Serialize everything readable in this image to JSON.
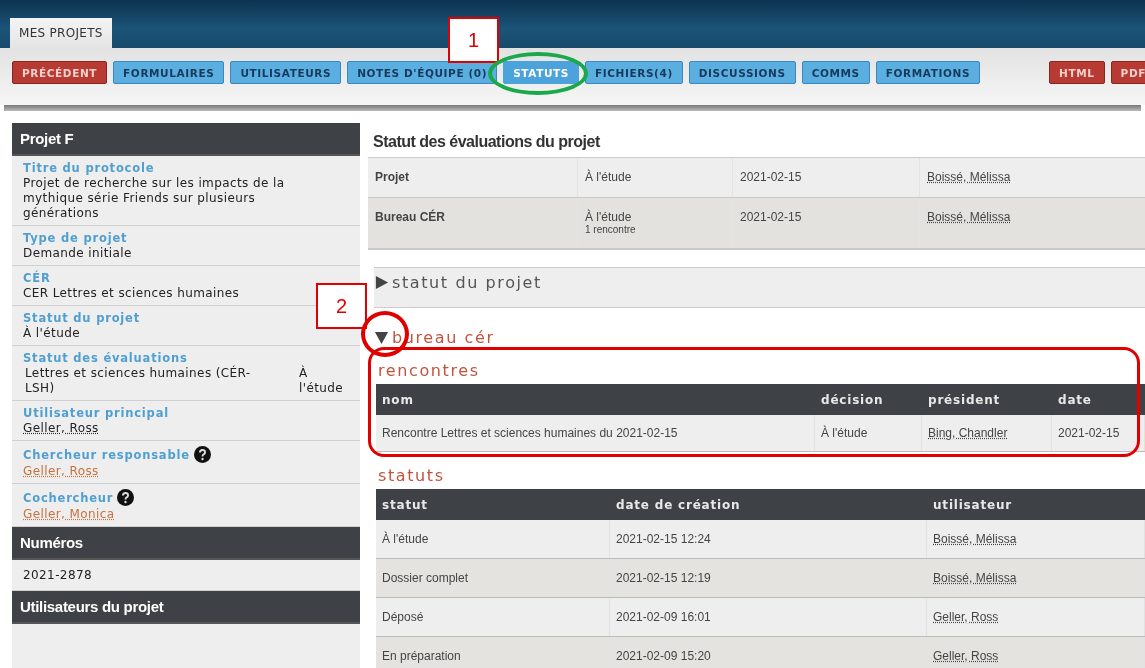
{
  "top_tabs": [
    {
      "label": "MES PROJETS",
      "selected": true
    }
  ],
  "toolbar": [
    {
      "label": "PRÉCÉDENT",
      "kind": "danger",
      "selected": false
    },
    {
      "label": "FORMULAIRES",
      "kind": "primary",
      "selected": false
    },
    {
      "label": "UTILISATEURS",
      "kind": "primary",
      "selected": false
    },
    {
      "label": "NOTES D'ÉQUIPE (0)",
      "kind": "primary",
      "selected": false
    },
    {
      "label": "STATUTS",
      "kind": "primary",
      "selected": true
    },
    {
      "label": "FICHIERS(4)",
      "kind": "primary",
      "selected": false
    },
    {
      "label": "DISCUSSIONS",
      "kind": "primary",
      "selected": false
    },
    {
      "label": "COMMS",
      "kind": "primary",
      "selected": false
    },
    {
      "label": "FORMATIONS",
      "kind": "primary",
      "selected": false
    }
  ],
  "toolbar_right": [
    {
      "label": "HTML",
      "kind": "danger",
      "selected": false
    },
    {
      "label": "PDF",
      "kind": "danger",
      "selected": false
    }
  ],
  "sidebar": {
    "title": "Projet F",
    "fields": [
      {
        "label": "Titre du protocole",
        "kind": "text",
        "value": "Projet de recherche sur les impacts de la mythique série Friends sur plusieurs générations",
        "help": false
      },
      {
        "label": "Type de projet",
        "kind": "text",
        "value": "Demande initiale",
        "help": false
      },
      {
        "label": "CÉR",
        "kind": "text",
        "value": "CER Lettres et sciences humaines",
        "help": false
      },
      {
        "label": "Statut du projet",
        "kind": "text",
        "value": "À l'étude",
        "help": false
      },
      {
        "label": "Statut des évaluations",
        "kind": "pair",
        "value": "Lettres et sciences humaines (CÉR-LSH)",
        "value_2": "À l'étude",
        "help": false
      },
      {
        "label": "Utilisateur principal",
        "kind": "person",
        "value": "Geller, Ross",
        "help": false
      },
      {
        "label": "Chercheur responsable",
        "kind": "link",
        "value": "Geller, Ross",
        "help": true
      },
      {
        "label": "Cochercheur",
        "kind": "link",
        "value": "Geller, Monica",
        "help": true
      }
    ],
    "numbers_title": "Numéros",
    "number": "2021-2878",
    "users_title": "Utilisateurs du projet"
  },
  "main": {
    "title": "Statut des évaluations du projet",
    "summary": [
      {
        "name": "Projet",
        "status": "À l'étude",
        "date": "2021-02-15",
        "user": "Boissé, Mélissa"
      },
      {
        "name": "Bureau CÉR",
        "status": "À l'étude",
        "note": "1 rencontre",
        "date": "2021-02-15",
        "user": "Boissé, Mélissa"
      }
    ],
    "sections": [
      {
        "title": "statut du projet",
        "expanded": false
      },
      {
        "title": "bureau cér",
        "expanded": true
      }
    ],
    "meetings": {
      "title": "rencontres",
      "columns": [
        "nom",
        "décision",
        "président",
        "date"
      ],
      "rows": [
        [
          "Rencontre Lettres et sciences humaines du 2021-02-15",
          "À l'étude",
          "Bing, Chandler",
          "2021-02-15"
        ]
      ]
    },
    "statuses": {
      "title": "statuts",
      "columns": [
        "statut",
        "date de création",
        "utilisateur"
      ],
      "rows": [
        [
          "À l'étude",
          "2021-02-15 12:24",
          "Boissé, Mélissa"
        ],
        [
          "Dossier complet",
          "2021-02-15 12:19",
          "Boissé, Mélissa"
        ],
        [
          "Déposé",
          "2021-02-09 16:01",
          "Geller, Ross"
        ],
        [
          "En préparation",
          "2021-02-09 15:20",
          "Geller, Ross"
        ]
      ]
    }
  },
  "annotations": [
    {
      "kind": "number",
      "text": "1"
    },
    {
      "kind": "ellipse"
    },
    {
      "kind": "number",
      "text": "2"
    },
    {
      "kind": "circle"
    },
    {
      "kind": "frame"
    }
  ]
}
